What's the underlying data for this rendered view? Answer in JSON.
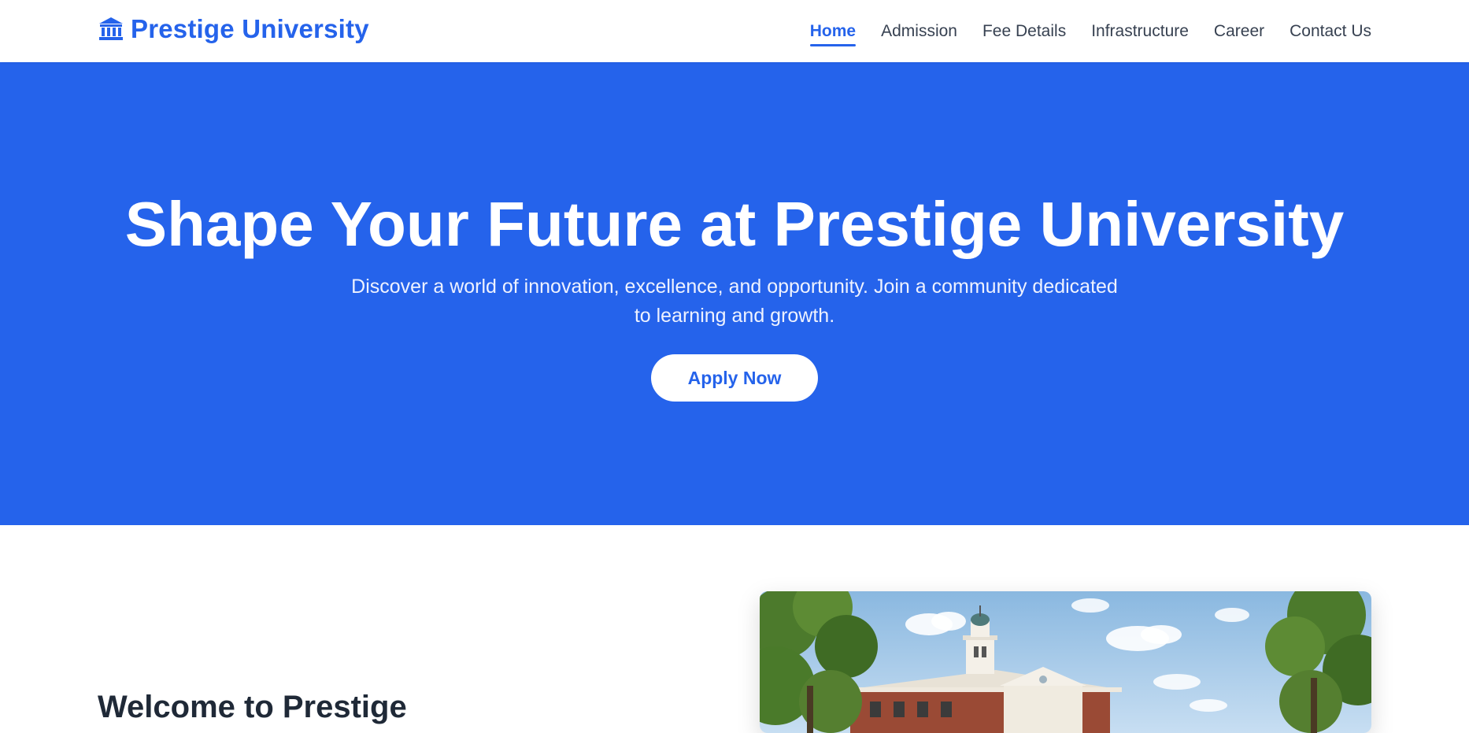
{
  "brand": {
    "name": "Prestige University",
    "icon": "university-building-icon"
  },
  "nav": {
    "items": [
      {
        "label": "Home",
        "active": true
      },
      {
        "label": "Admission",
        "active": false
      },
      {
        "label": "Fee Details",
        "active": false
      },
      {
        "label": "Infrastructure",
        "active": false
      },
      {
        "label": "Career",
        "active": false
      },
      {
        "label": "Contact Us",
        "active": false
      }
    ]
  },
  "hero": {
    "title": "Shape Your Future at Prestige University",
    "subtitle": "Discover a world of innovation, excellence, and opportunity. Join a community dedicated to learning and growth.",
    "cta_label": "Apply Now"
  },
  "about": {
    "heading": "Welcome to Prestige"
  },
  "colors": {
    "primary": "#2563eb",
    "heading_text": "#1f2937",
    "nav_text": "#374151",
    "background": "#ffffff"
  }
}
